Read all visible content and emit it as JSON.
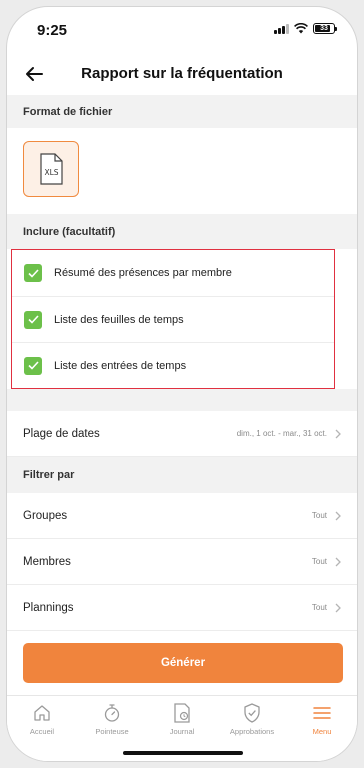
{
  "status_bar": {
    "time": "9:25",
    "battery": "33"
  },
  "header": {
    "title": "Rapport sur la fréquentation",
    "back_icon": "arrow-left-icon"
  },
  "file_format": {
    "heading": "Format de fichier",
    "option_label": "XLS",
    "selected": true,
    "accent": "#f0843d"
  },
  "include": {
    "heading": "Inclure (facultatif)",
    "items": [
      {
        "label": "Résumé des présences par membre",
        "checked": true
      },
      {
        "label": "Liste des feuilles de temps",
        "checked": true
      },
      {
        "label": "Liste des entrées de temps",
        "checked": true
      }
    ],
    "check_color": "#6cc04a",
    "highlight_color": "#e03040"
  },
  "date_range": {
    "label": "Plage de dates",
    "value": "dim., 1 oct. - mar., 31 oct."
  },
  "filter": {
    "heading": "Filtrer par",
    "rows": [
      {
        "label": "Groupes",
        "value": "Tout"
      },
      {
        "label": "Membres",
        "value": "Tout"
      },
      {
        "label": "Plannings",
        "value": "Tout"
      }
    ]
  },
  "generate_button": {
    "label": "Générer",
    "color": "#f0843d"
  },
  "tabbar": {
    "tabs": [
      {
        "label": "Accueil",
        "icon": "home-icon",
        "active": false
      },
      {
        "label": "Pointeuse",
        "icon": "stopwatch-icon",
        "active": false
      },
      {
        "label": "Journal",
        "icon": "timesheet-icon",
        "active": false
      },
      {
        "label": "Approbations",
        "icon": "shield-check-icon",
        "active": false
      },
      {
        "label": "Menu",
        "icon": "hamburger-menu-icon",
        "active": true
      }
    ]
  }
}
